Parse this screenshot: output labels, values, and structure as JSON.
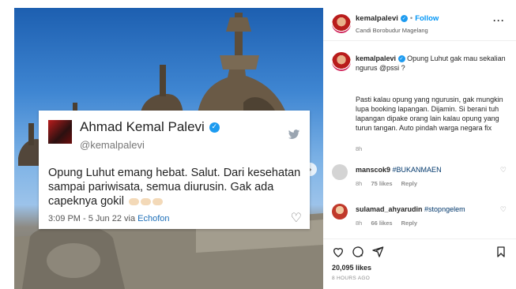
{
  "tweet": {
    "name": "Ahmad Kemal Palevi",
    "handle": "@kemalpalevi",
    "text": "Opung Luhut emang hebat. Salut. Dari kesehatan sampai pariwisata, semua diurusin. Gak ada capeknya gokil",
    "timestamp": "3:09 PM - 5 Jun 22 via",
    "via": "Echofon"
  },
  "post": {
    "username": "kemalpalevi",
    "separator": "•",
    "follow_label": "Follow",
    "location": "Candi Borobudur Magelang",
    "more_label": "···"
  },
  "caption": {
    "username": "kemalpalevi",
    "line1": "Opung Luhut gak mau sekalian ngurus @pssi ?",
    "body": "Pasti kalau opung yang ngurusin, gak mungkin lupa booking lapangan. Dijamin. Si berani tuh lapangan dipake orang lain kalau opung yang turun tangan. Auto pindah warga negara fix",
    "time": "8h"
  },
  "comments": [
    {
      "username": "manscok9",
      "text": "#BUKANMAEN",
      "time": "8h",
      "likes": "75 likes",
      "reply": "Reply"
    },
    {
      "username": "sulamad_ahyarudin",
      "text": "#stopngelem",
      "time": "8h",
      "likes": "66 likes",
      "reply": "Reply"
    }
  ],
  "likes_count": "20,095 likes",
  "posted_ago": "8 HOURS AGO",
  "icons": {
    "heart": "heart-icon",
    "comment": "comment-icon",
    "share": "share-icon",
    "save": "bookmark-icon",
    "verified": "verified-badge-icon",
    "twitter": "twitter-bird-icon",
    "next": "chevron-right-icon"
  },
  "colors": {
    "follow": "#0095f6",
    "verified": "#1d9bf0",
    "hashtag": "#00376b",
    "sky": "#3f86d2"
  }
}
